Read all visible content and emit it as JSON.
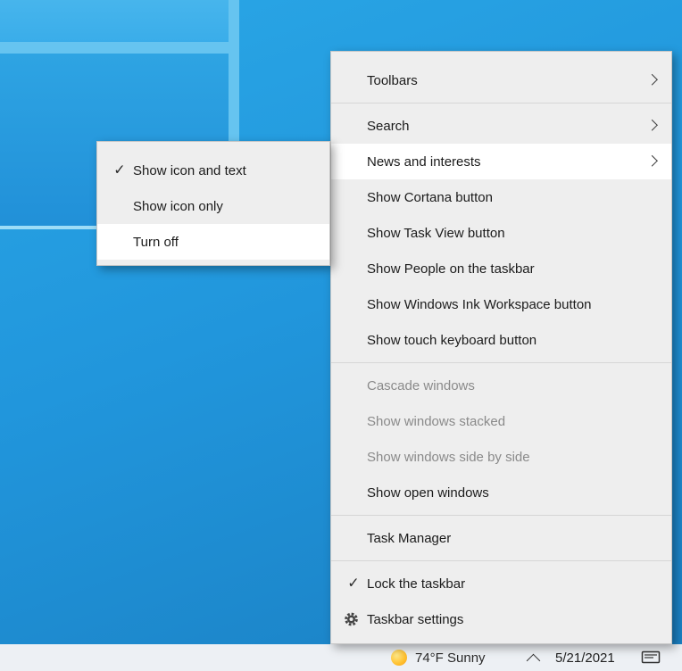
{
  "colors": {
    "menu_bg": "#eeeeee",
    "menu_highlight": "#ffffff",
    "menu_text": "#1b1b1b",
    "menu_disabled_text": "#8a8a8a",
    "taskbar_bg": "#edf0f4",
    "wallpaper_blue": "#2196dc"
  },
  "icons": {
    "check": "✓"
  },
  "taskbar_menu": {
    "toolbars": "Toolbars",
    "search": "Search",
    "news_and_interests": "News and interests",
    "show_cortana": "Show Cortana button",
    "show_task_view": "Show Task View button",
    "show_people": "Show People on the taskbar",
    "show_ink_workspace": "Show Windows Ink Workspace button",
    "show_touch_keyboard": "Show touch keyboard button",
    "cascade_windows": "Cascade windows",
    "show_windows_stacked": "Show windows stacked",
    "show_windows_side_by_side": "Show windows side by side",
    "show_open_windows": "Show open windows",
    "task_manager": "Task Manager",
    "lock_the_taskbar": "Lock the taskbar",
    "taskbar_settings": "Taskbar settings"
  },
  "news_submenu": {
    "show_icon_and_text": "Show icon and text",
    "show_icon_only": "Show icon only",
    "turn_off": "Turn off"
  },
  "taskbar": {
    "weather": "74°F Sunny",
    "date": "5/21/2021"
  }
}
